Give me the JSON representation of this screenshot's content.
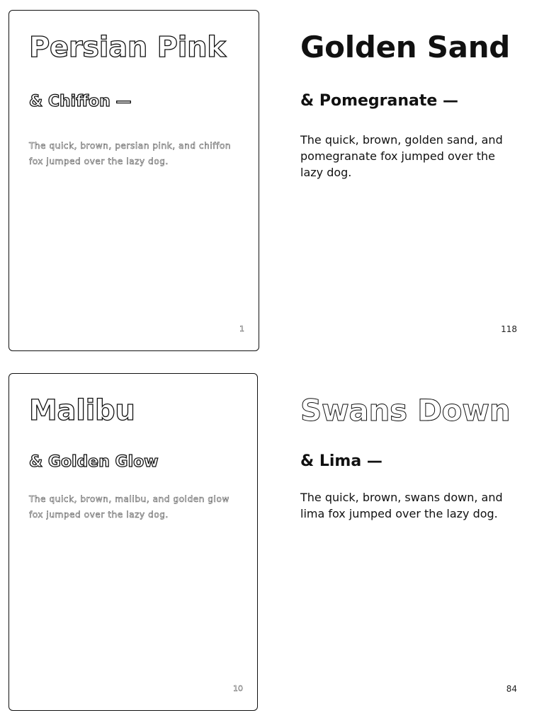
{
  "cards": [
    {
      "title": "Persian Pink",
      "subtitle": "& Chiffon —",
      "body": "The quick, brown, persian pink, and chiffon fox jumped over the lazy dog.",
      "page_number": "1"
    },
    {
      "title": "Malibu",
      "subtitle": "& Golden Glow",
      "body": "The quick, brown, malibu, and golden glow fox jumped over the lazy dog.",
      "page_number": "10"
    }
  ],
  "panels": [
    {
      "title": "Golden Sand",
      "subtitle": "& Pomegranate —",
      "body": "The quick, brown, golden sand, and pomegranate fox jumped over the lazy dog.",
      "page_number": "118"
    },
    {
      "title": "Swans Down",
      "subtitle": "& Lima —",
      "body": "The quick, brown, swans down, and lima fox jumped over the lazy dog.",
      "page_number": "84"
    }
  ]
}
